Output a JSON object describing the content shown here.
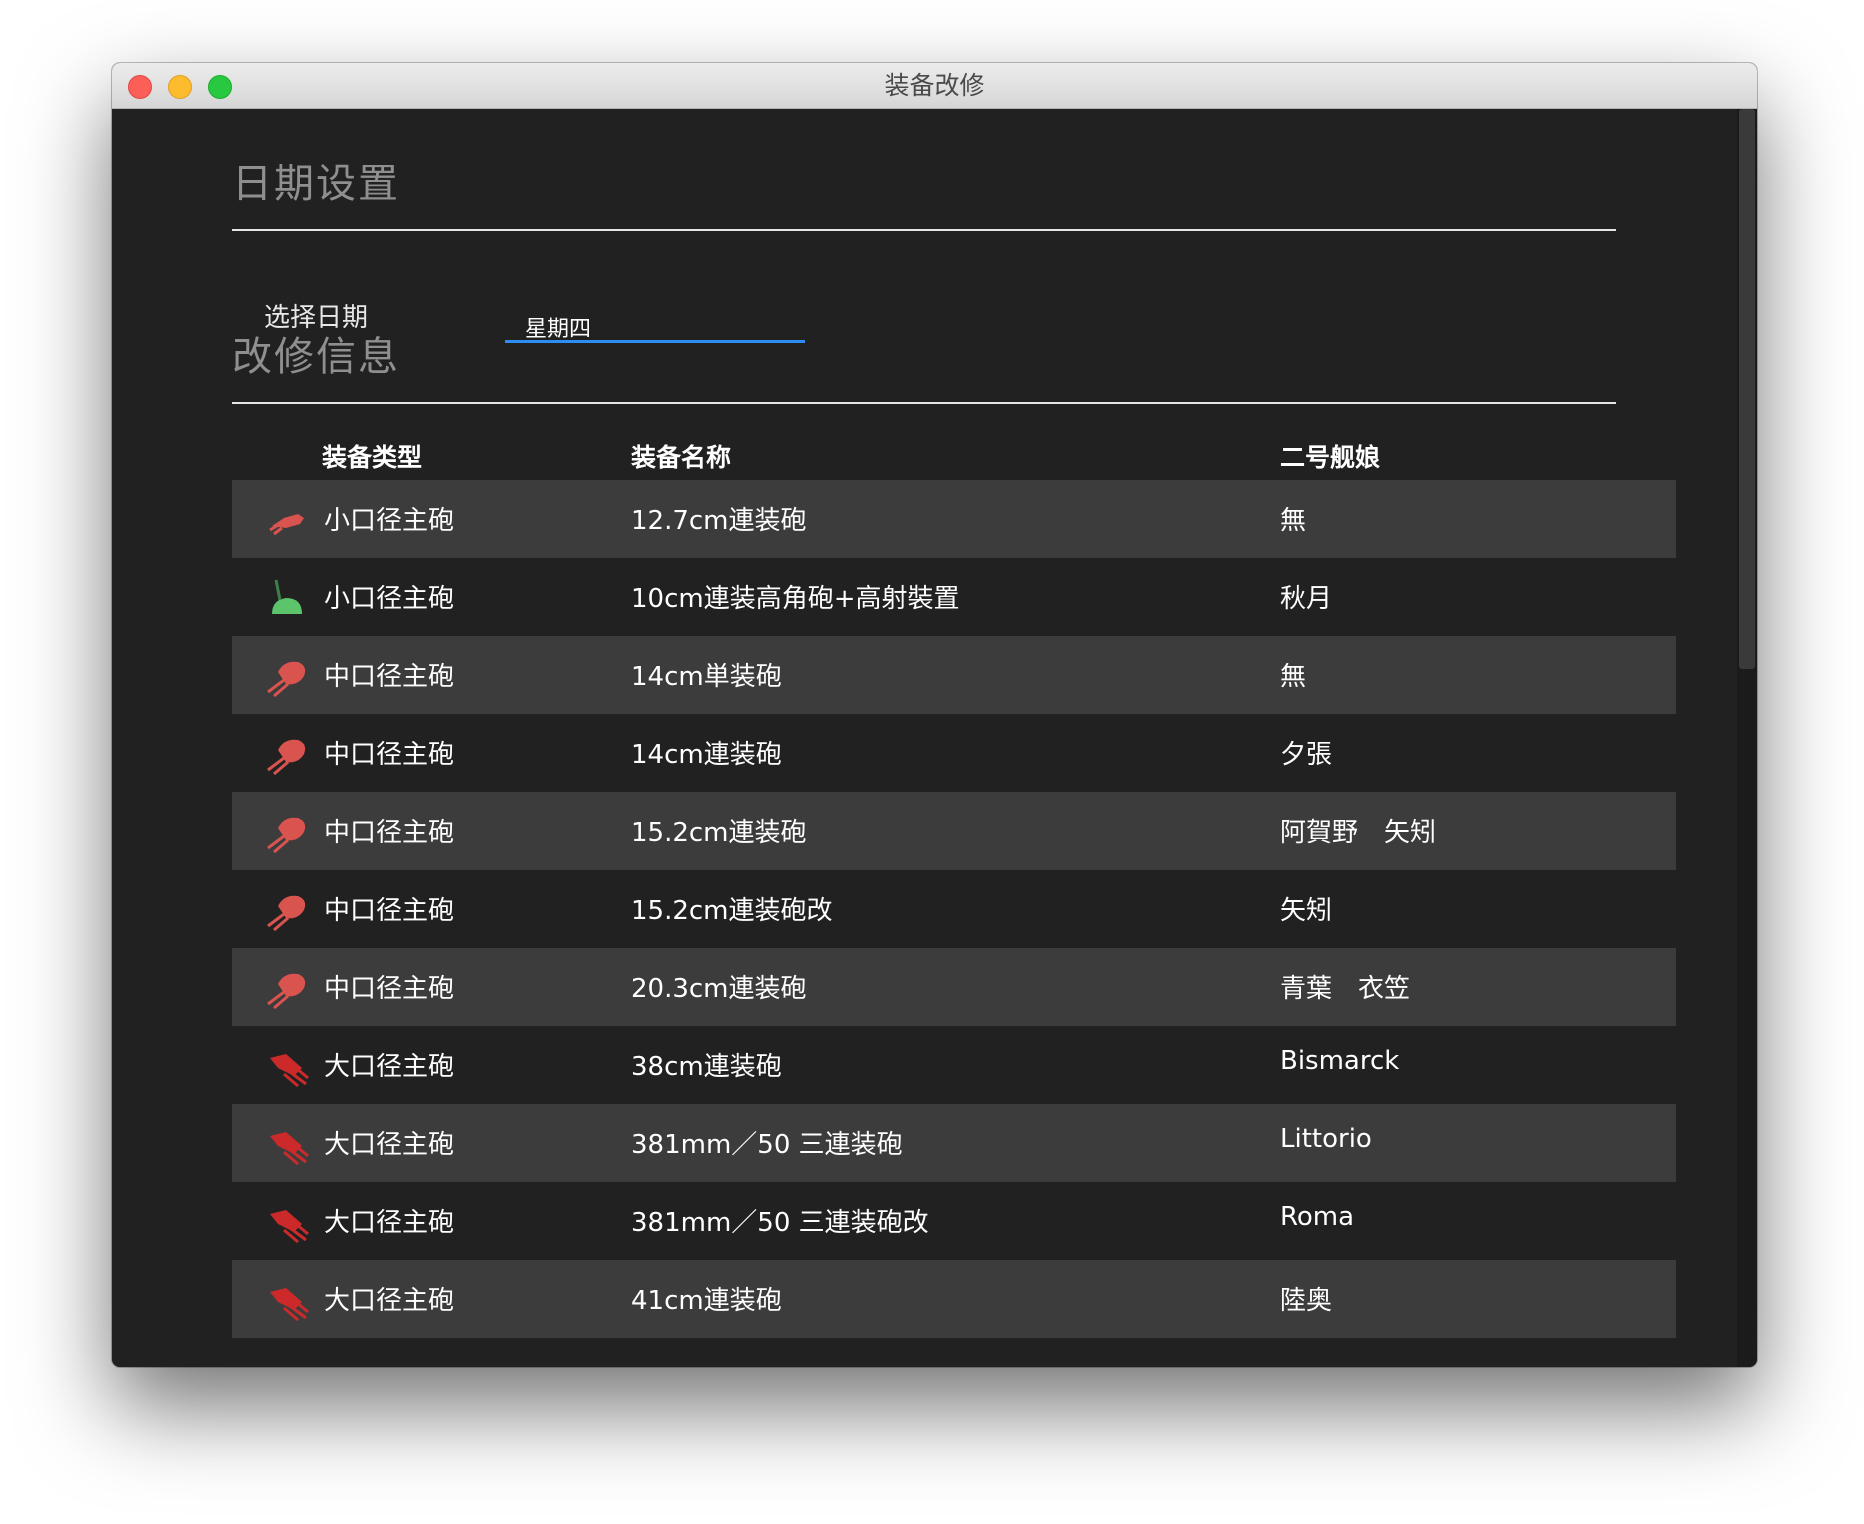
{
  "window": {
    "title": "装备改修"
  },
  "date_section": {
    "title": "日期设置",
    "label": "选择日期",
    "selected_day": "星期四"
  },
  "info_section": {
    "title": "改修信息"
  },
  "table": {
    "headers": {
      "type": "装备类型",
      "name": "装备名称",
      "ship": "二号舰娘"
    },
    "rows": [
      {
        "icon": "small-gun-icon",
        "color": "#d9534f",
        "type": "小口径主砲",
        "name": "12.7cm連装砲",
        "ship": "無"
      },
      {
        "icon": "aa-gun-icon",
        "color": "#5cc56c",
        "type": "小口径主砲",
        "name": "10cm連装高角砲+高射裝置",
        "ship": "秋月"
      },
      {
        "icon": "medium-gun-icon",
        "color": "#d9534f",
        "type": "中口径主砲",
        "name": "14cm単装砲",
        "ship": "無"
      },
      {
        "icon": "medium-gun-icon",
        "color": "#d9534f",
        "type": "中口径主砲",
        "name": "14cm連装砲",
        "ship": "夕張"
      },
      {
        "icon": "medium-gun-icon",
        "color": "#d9534f",
        "type": "中口径主砲",
        "name": "15.2cm連装砲",
        "ship": "阿賀野　矢矧"
      },
      {
        "icon": "medium-gun-icon",
        "color": "#d9534f",
        "type": "中口径主砲",
        "name": "15.2cm連装砲改",
        "ship": "矢矧"
      },
      {
        "icon": "medium-gun-icon",
        "color": "#d9534f",
        "type": "中口径主砲",
        "name": "20.3cm連装砲",
        "ship": "青葉　衣笠"
      },
      {
        "icon": "large-gun-icon",
        "color": "#cc2a2a",
        "type": "大口径主砲",
        "name": "38cm連装砲",
        "ship": "Bismarck"
      },
      {
        "icon": "large-gun-icon",
        "color": "#cc2a2a",
        "type": "大口径主砲",
        "name": "381mm／50 三連装砲",
        "ship": "Littorio"
      },
      {
        "icon": "large-gun-icon",
        "color": "#cc2a2a",
        "type": "大口径主砲",
        "name": "381mm／50 三連装砲改",
        "ship": "Roma"
      },
      {
        "icon": "large-gun-icon",
        "color": "#cc2a2a",
        "type": "大口径主砲",
        "name": "41cm連装砲",
        "ship": "陸奥"
      }
    ]
  },
  "colors": {
    "background": "#212121",
    "row_shade": "#3c3c3c",
    "accent": "#2b8ef2"
  }
}
